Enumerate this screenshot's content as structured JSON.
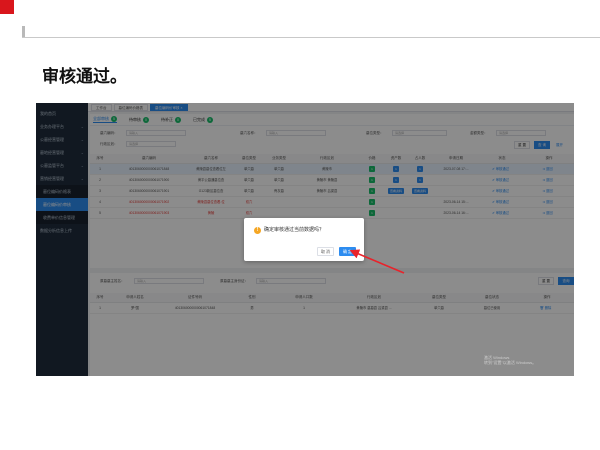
{
  "slide": {
    "heading": "审核通过。"
  },
  "app": {
    "sidebar": [
      {
        "label": "我的首页",
        "type": "item"
      },
      {
        "label": "业务办理平台",
        "type": "group"
      },
      {
        "label": "公墓经营管理",
        "type": "group"
      },
      {
        "label": "墓地经营管理",
        "type": "group"
      },
      {
        "label": "公墓监管平台",
        "type": "group"
      },
      {
        "label": "营销经营管理",
        "type": "group"
      },
      {
        "label": "墓位编码价格表",
        "type": "sub"
      },
      {
        "label": "墓位编码价审核",
        "type": "sub-active"
      },
      {
        "label": "收费单价信息管理",
        "type": "sub"
      },
      {
        "label": "数据分析信息上传",
        "type": "item"
      }
    ],
    "tabs": [
      {
        "label": "工作台",
        "active": false
      },
      {
        "label": "墓位编码价格表",
        "active": false
      },
      {
        "label": "墓位编码价审核 ×",
        "active": true
      }
    ],
    "status_tabs": [
      {
        "label": "全部审核",
        "count": "5",
        "active": true
      },
      {
        "label": "待审核",
        "count": "0",
        "active": false
      },
      {
        "label": "待补正",
        "count": "0",
        "active": false
      },
      {
        "label": "已完成",
        "count": "5",
        "active": false
      }
    ],
    "filters": {
      "code_label": "墓穴编码：",
      "code_placeholder": "请输入",
      "name_label": "墓穴名称：",
      "name_placeholder": "请输入",
      "type_label": "墓位类型：",
      "type_placeholder": "请选择",
      "price_label": "金额类型：",
      "price_placeholder": "请选择",
      "region_label": "行政区划：",
      "region_placeholder": "请选择",
      "reset": "重 置",
      "query": "查 询",
      "expand": "展开"
    },
    "table": {
      "headers": [
        "序号",
        "墓穴编码",
        "墓穴名称",
        "墓位类型",
        "业务类型",
        "行政区划",
        "价格",
        "资产数",
        "占人数",
        "申请日期",
        "状态",
        "操作"
      ],
      "rows": [
        {
          "no": "1",
          "code": "4013060000000061071848",
          "name": "黄陵县墓位查看位左",
          "kind": "单穴墓",
          "biz": "单穴墓",
          "region": "黄陵市",
          "price": "1",
          "assets": "1",
          "people": "1",
          "date": "2023-07-08 17:...",
          "status": "审核通过",
          "op": "退回",
          "selected": true,
          "red": false
        },
        {
          "no": "2",
          "code": "4013060000000061071900",
          "name": "黄平公墓通墓位查",
          "kind": "单穴墓",
          "biz": "单穴墓",
          "region": "黄陵市 黄陵县",
          "price": "1",
          "assets": "1",
          "people": "1",
          "date": "",
          "status": "审核通过",
          "op": "退回",
          "selected": false,
          "red": false
        },
        {
          "no": "3",
          "code": "4013060000000061071901",
          "name": "G123新区墓位查",
          "kind": "单穴墓",
          "biz": "骨灰墓",
          "region": "黄陵市 吕梁县",
          "price": "1",
          "assets": "查看资料",
          "people": "查看资料",
          "date": "",
          "status": "审核通过",
          "op": "退回",
          "selected": false,
          "red": false
        },
        {
          "no": "4",
          "code": "4013060000000061071902",
          "name": "黄陵县墓位查看-位",
          "kind": "双穴",
          "biz": "",
          "region": "",
          "price": "1",
          "assets": "",
          "people": "",
          "date": "2023-06-14 15:...",
          "status": "审核通过",
          "op": "退回",
          "selected": false,
          "red": true
        },
        {
          "no": "5",
          "code": "4013060000000061071903",
          "name": "黄陵",
          "kind": "双穴",
          "biz": "",
          "region": "",
          "price": "1",
          "assets": "",
          "people": "",
          "date": "2023-06-14 16:...",
          "status": "审核通过",
          "op": "退回",
          "selected": false,
          "red": true
        }
      ]
    },
    "lower": {
      "filter1_label": "原墓墓主姓名：",
      "filter1_placeholder": "请输入",
      "filter2_label": "原墓墓主身份证：",
      "filter2_placeholder": "请输入",
      "reset": "重 置",
      "query": "查询",
      "headers": [
        "序号",
        "申请人姓名",
        "证件号码",
        "性别",
        "申请人口数",
        "行政区划",
        "墓位类型",
        "墓位状态",
        "操作"
      ],
      "row": {
        "no": "1",
        "name": "罗*国",
        "id": "4013060000000061071848",
        "gender": "男",
        "count": "1",
        "region": "黄陵市 墓墓县 吕梁县 ...",
        "kind": "单穴墓",
        "state": "墓位已使用",
        "op": "删除"
      }
    },
    "dialog": {
      "message": "确定审核通过当前数据吗？",
      "cancel": "取 消",
      "confirm": "确 定"
    },
    "watermark": {
      "line1": "激活 Windows",
      "line2": "转到\"设置\"以激活 Windows。"
    }
  }
}
